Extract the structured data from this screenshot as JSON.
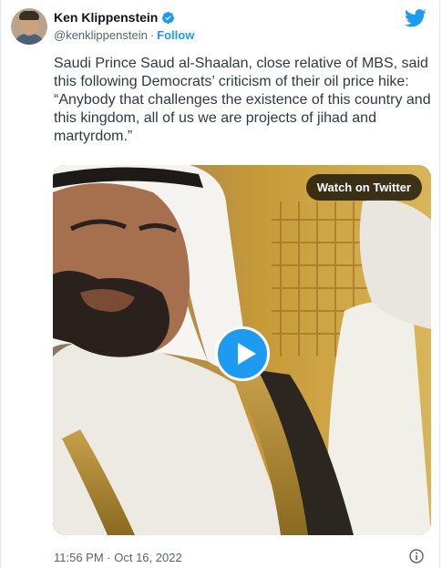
{
  "author": {
    "name": "Ken Klippenstein",
    "handle": "@kenklippenstein",
    "follow_label": "Follow"
  },
  "tweet": {
    "text": "Saudi Prince Saud al-Shaalan, close relative of MBS, said this following Democrats’ criticism of their oil price hike: “Anybody that challenges the existence of this country and this kingdom, all of us we are projects of jihad and martyrdom.”",
    "timestamp": "11:56 PM · Oct 16, 2022"
  },
  "media": {
    "watch_label": "Watch on Twitter",
    "type": "video"
  },
  "colors": {
    "accent": "#1d9bf0",
    "text": "#0f1419",
    "secondary": "#536471"
  },
  "icons": [
    "verified-badge-icon",
    "twitter-bird-icon",
    "play-icon",
    "info-icon"
  ]
}
